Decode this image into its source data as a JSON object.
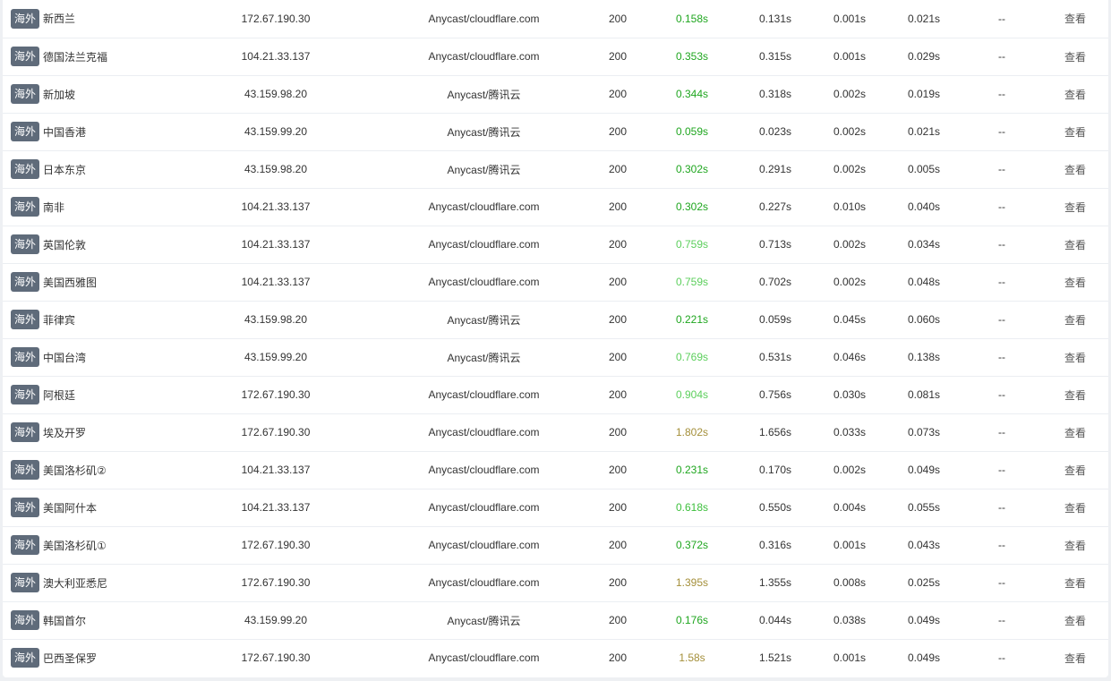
{
  "region_badge": "海外",
  "view_label": "查看",
  "colors": {
    "fast": "#1fa61f",
    "medium": "#3cbf3c",
    "fair": "#5ccf5c",
    "slow": "#a48f3a"
  },
  "rows": [
    {
      "node": "新西兰",
      "ip": "172.67.190.30",
      "location": "Anycast/cloudflare.com",
      "status": "200",
      "total": "0.158s",
      "total_level": "fast",
      "resolve": "0.131s",
      "connect": "0.001s",
      "download": "0.021s",
      "extra": "--"
    },
    {
      "node": "德国法兰克福",
      "ip": "104.21.33.137",
      "location": "Anycast/cloudflare.com",
      "status": "200",
      "total": "0.353s",
      "total_level": "fast",
      "resolve": "0.315s",
      "connect": "0.001s",
      "download": "0.029s",
      "extra": "--"
    },
    {
      "node": "新加坡",
      "ip": "43.159.98.20",
      "location": "Anycast/腾讯云",
      "status": "200",
      "total": "0.344s",
      "total_level": "fast",
      "resolve": "0.318s",
      "connect": "0.002s",
      "download": "0.019s",
      "extra": "--"
    },
    {
      "node": "中国香港",
      "ip": "43.159.99.20",
      "location": "Anycast/腾讯云",
      "status": "200",
      "total": "0.059s",
      "total_level": "fast",
      "resolve": "0.023s",
      "connect": "0.002s",
      "download": "0.021s",
      "extra": "--"
    },
    {
      "node": "日本东京",
      "ip": "43.159.98.20",
      "location": "Anycast/腾讯云",
      "status": "200",
      "total": "0.302s",
      "total_level": "fast",
      "resolve": "0.291s",
      "connect": "0.002s",
      "download": "0.005s",
      "extra": "--"
    },
    {
      "node": "南非",
      "ip": "104.21.33.137",
      "location": "Anycast/cloudflare.com",
      "status": "200",
      "total": "0.302s",
      "total_level": "fast",
      "resolve": "0.227s",
      "connect": "0.010s",
      "download": "0.040s",
      "extra": "--"
    },
    {
      "node": "英国伦敦",
      "ip": "104.21.33.137",
      "location": "Anycast/cloudflare.com",
      "status": "200",
      "total": "0.759s",
      "total_level": "fair",
      "resolve": "0.713s",
      "connect": "0.002s",
      "download": "0.034s",
      "extra": "--"
    },
    {
      "node": "美国西雅图",
      "ip": "104.21.33.137",
      "location": "Anycast/cloudflare.com",
      "status": "200",
      "total": "0.759s",
      "total_level": "fair",
      "resolve": "0.702s",
      "connect": "0.002s",
      "download": "0.048s",
      "extra": "--"
    },
    {
      "node": "菲律宾",
      "ip": "43.159.98.20",
      "location": "Anycast/腾讯云",
      "status": "200",
      "total": "0.221s",
      "total_level": "fast",
      "resolve": "0.059s",
      "connect": "0.045s",
      "download": "0.060s",
      "extra": "--"
    },
    {
      "node": "中国台湾",
      "ip": "43.159.99.20",
      "location": "Anycast/腾讯云",
      "status": "200",
      "total": "0.769s",
      "total_level": "fair",
      "resolve": "0.531s",
      "connect": "0.046s",
      "download": "0.138s",
      "extra": "--"
    },
    {
      "node": "阿根廷",
      "ip": "172.67.190.30",
      "location": "Anycast/cloudflare.com",
      "status": "200",
      "total": "0.904s",
      "total_level": "fair",
      "resolve": "0.756s",
      "connect": "0.030s",
      "download": "0.081s",
      "extra": "--"
    },
    {
      "node": "埃及开罗",
      "ip": "172.67.190.30",
      "location": "Anycast/cloudflare.com",
      "status": "200",
      "total": "1.802s",
      "total_level": "slow",
      "resolve": "1.656s",
      "connect": "0.033s",
      "download": "0.073s",
      "extra": "--"
    },
    {
      "node": "美国洛杉矶②",
      "ip": "104.21.33.137",
      "location": "Anycast/cloudflare.com",
      "status": "200",
      "total": "0.231s",
      "total_level": "fast",
      "resolve": "0.170s",
      "connect": "0.002s",
      "download": "0.049s",
      "extra": "--"
    },
    {
      "node": "美国阿什本",
      "ip": "104.21.33.137",
      "location": "Anycast/cloudflare.com",
      "status": "200",
      "total": "0.618s",
      "total_level": "medium",
      "resolve": "0.550s",
      "connect": "0.004s",
      "download": "0.055s",
      "extra": "--"
    },
    {
      "node": "美国洛杉矶①",
      "ip": "172.67.190.30",
      "location": "Anycast/cloudflare.com",
      "status": "200",
      "total": "0.372s",
      "total_level": "fast",
      "resolve": "0.316s",
      "connect": "0.001s",
      "download": "0.043s",
      "extra": "--"
    },
    {
      "node": "澳大利亚悉尼",
      "ip": "172.67.190.30",
      "location": "Anycast/cloudflare.com",
      "status": "200",
      "total": "1.395s",
      "total_level": "slow",
      "resolve": "1.355s",
      "connect": "0.008s",
      "download": "0.025s",
      "extra": "--"
    },
    {
      "node": "韩国首尔",
      "ip": "43.159.99.20",
      "location": "Anycast/腾讯云",
      "status": "200",
      "total": "0.176s",
      "total_level": "fast",
      "resolve": "0.044s",
      "connect": "0.038s",
      "download": "0.049s",
      "extra": "--"
    },
    {
      "node": "巴西圣保罗",
      "ip": "172.67.190.30",
      "location": "Anycast/cloudflare.com",
      "status": "200",
      "total": "1.58s",
      "total_level": "slow",
      "resolve": "1.521s",
      "connect": "0.001s",
      "download": "0.049s",
      "extra": "--"
    }
  ]
}
